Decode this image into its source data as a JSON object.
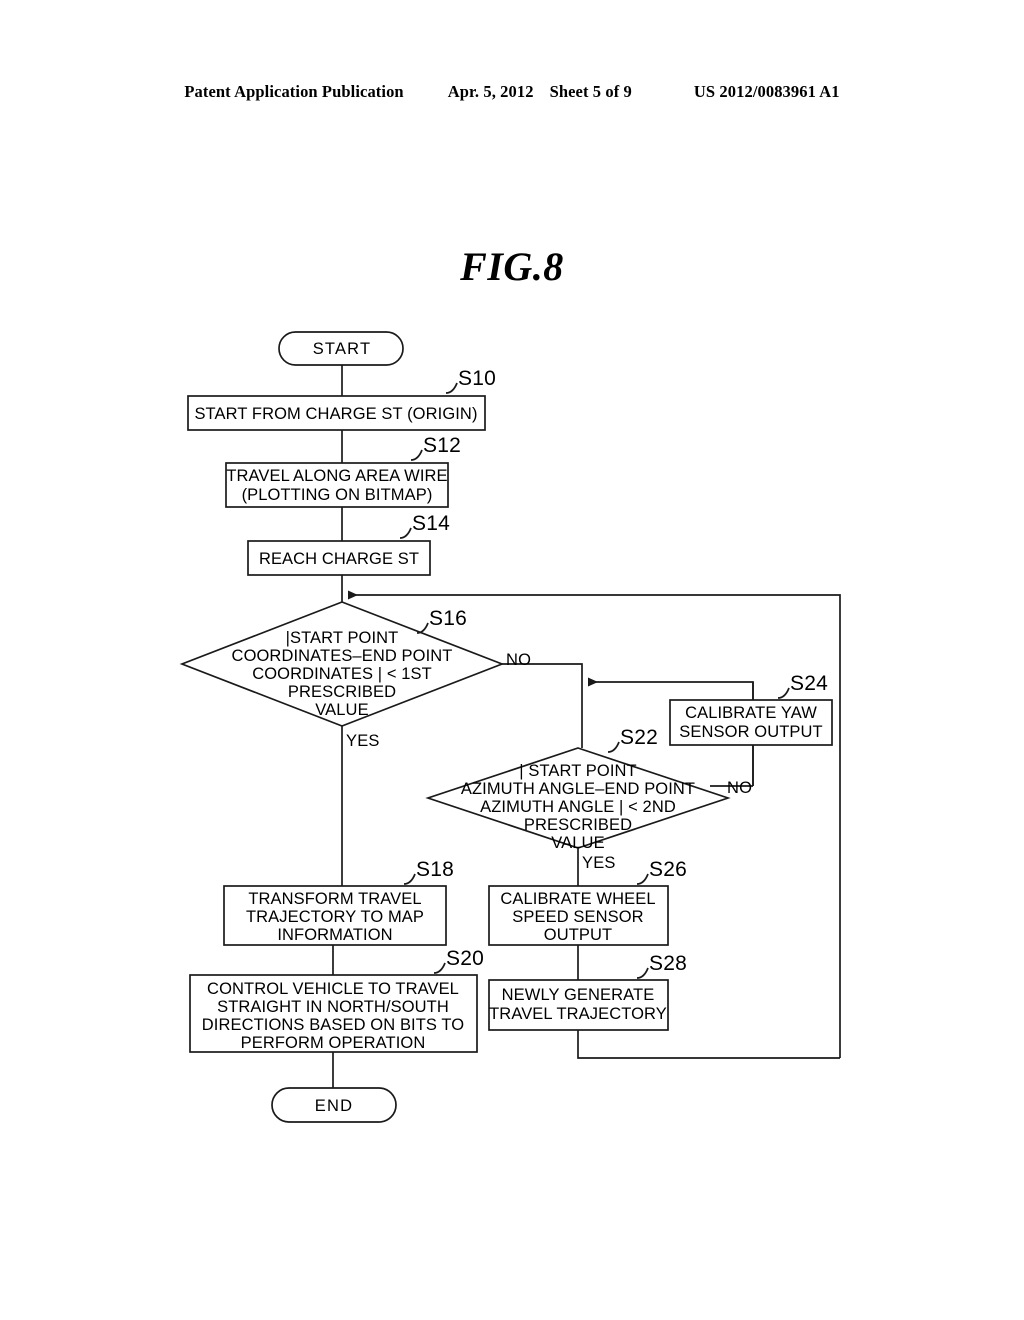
{
  "header": {
    "publication": "Patent Application Publication",
    "date": "Apr. 5, 2012",
    "sheet": "Sheet 5 of 9",
    "number": "US 2012/0083961 A1"
  },
  "figure": {
    "title": "FIG.8"
  },
  "flowchart": {
    "terminators": {
      "start": "START",
      "end": "END"
    },
    "steps": [
      {
        "id": "S10",
        "label": "S10",
        "lines": [
          "START FROM CHARGE ST (ORIGIN)"
        ]
      },
      {
        "id": "S12",
        "label": "S12",
        "lines": [
          "TRAVEL ALONG AREA WIRE",
          "(PLOTTING ON BITMAP)"
        ]
      },
      {
        "id": "S14",
        "label": "S14",
        "lines": [
          "REACH CHARGE ST"
        ]
      },
      {
        "id": "S16",
        "label": "S16",
        "lines": [
          "|START POINT",
          "COORDINATES–END POINT",
          "COORDINATES | < 1ST",
          "PRESCRIBED",
          "VALUE"
        ],
        "yes": "YES",
        "no": "NO"
      },
      {
        "id": "S18",
        "label": "S18",
        "lines": [
          "TRANSFORM TRAVEL",
          "TRAJECTORY TO MAP",
          "INFORMATION"
        ]
      },
      {
        "id": "S20",
        "label": "S20",
        "lines": [
          "CONTROL VEHICLE TO TRAVEL",
          "STRAIGHT IN NORTH/SOUTH",
          "DIRECTIONS  BASED ON BITS TO",
          "PERFORM OPERATION"
        ]
      },
      {
        "id": "S22",
        "label": "S22",
        "lines": [
          "| START POINT",
          "AZIMUTH ANGLE–END POINT",
          "AZIMUTH ANGLE | < 2ND",
          "PRESCRIBED",
          "VALUE"
        ],
        "yes": "YES",
        "no": "NO"
      },
      {
        "id": "S24",
        "label": "S24",
        "lines": [
          "CALIBRATE YAW",
          "SENSOR OUTPUT"
        ]
      },
      {
        "id": "S26",
        "label": "S26",
        "lines": [
          "CALIBRATE WHEEL",
          "SPEED SENSOR",
          "OUTPUT"
        ]
      },
      {
        "id": "S28",
        "label": "S28",
        "lines": [
          "NEWLY GENERATE",
          "TRAVEL TRAJECTORY"
        ]
      }
    ]
  }
}
